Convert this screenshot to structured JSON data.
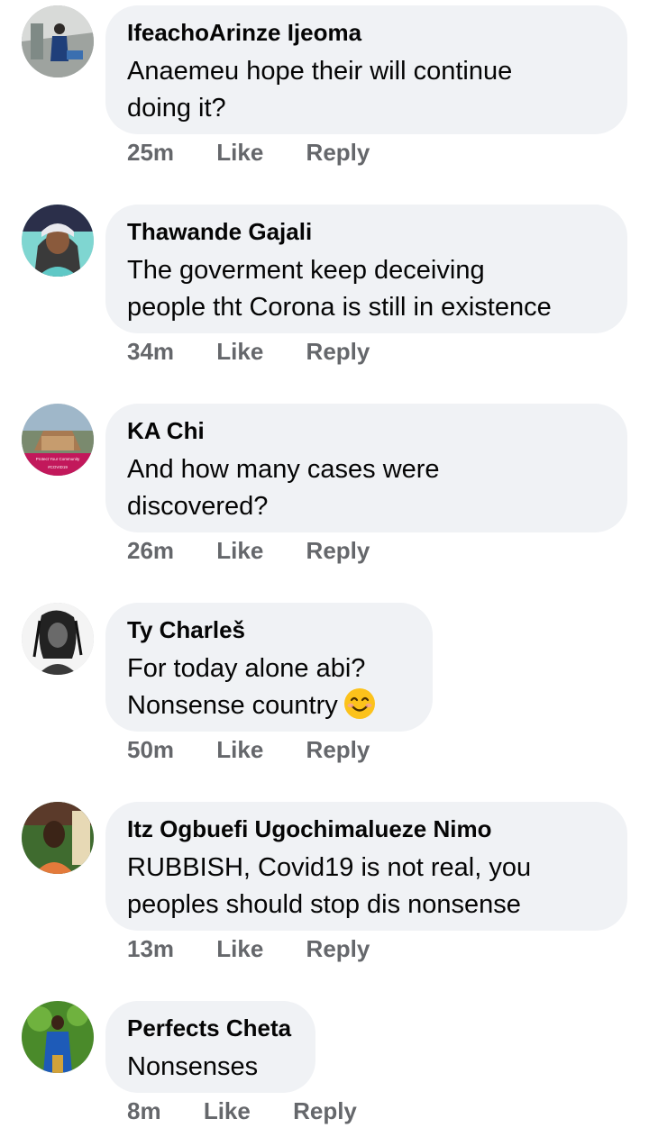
{
  "comments": [
    {
      "author": "IfeachoArinze Ijeoma",
      "text": "Anaemeu hope their will continue\ndoing it?",
      "time": "25m",
      "like": "Like",
      "reply": "Reply"
    },
    {
      "author": "Thawande Gajali",
      "text": "The goverment keep deceiving\npeople tht Corona is still in existence",
      "time": "34m",
      "like": "Like",
      "reply": "Reply"
    },
    {
      "author": "KA Chi",
      "text": "And how many cases were\ndiscovered?",
      "time": "26m",
      "like": "Like",
      "reply": "Reply"
    },
    {
      "author": "Ty Charleš",
      "text_line1": "For today alone abi?",
      "text_line2": "Nonsense country",
      "emoji": "smiling-face-emoji",
      "time": "50m",
      "like": "Like",
      "reply": "Reply"
    },
    {
      "author": "Itz Ogbuefi Ugochimalueze Nimo",
      "text": "RUBBISH, Covid19 is not real, you\npeoples should stop dis nonsense",
      "time": "13m",
      "like": "Like",
      "reply": "Reply"
    },
    {
      "author": "Perfects Cheta",
      "text": "Nonsenses",
      "time": "8m",
      "like": "Like",
      "reply": "Reply"
    }
  ],
  "avatar_badge": {
    "line1": "Protect Your Community",
    "line2": "#COVID19"
  },
  "colors": {
    "bubble": "#f0f2f5",
    "text": "#050505",
    "meta": "#65676b"
  }
}
